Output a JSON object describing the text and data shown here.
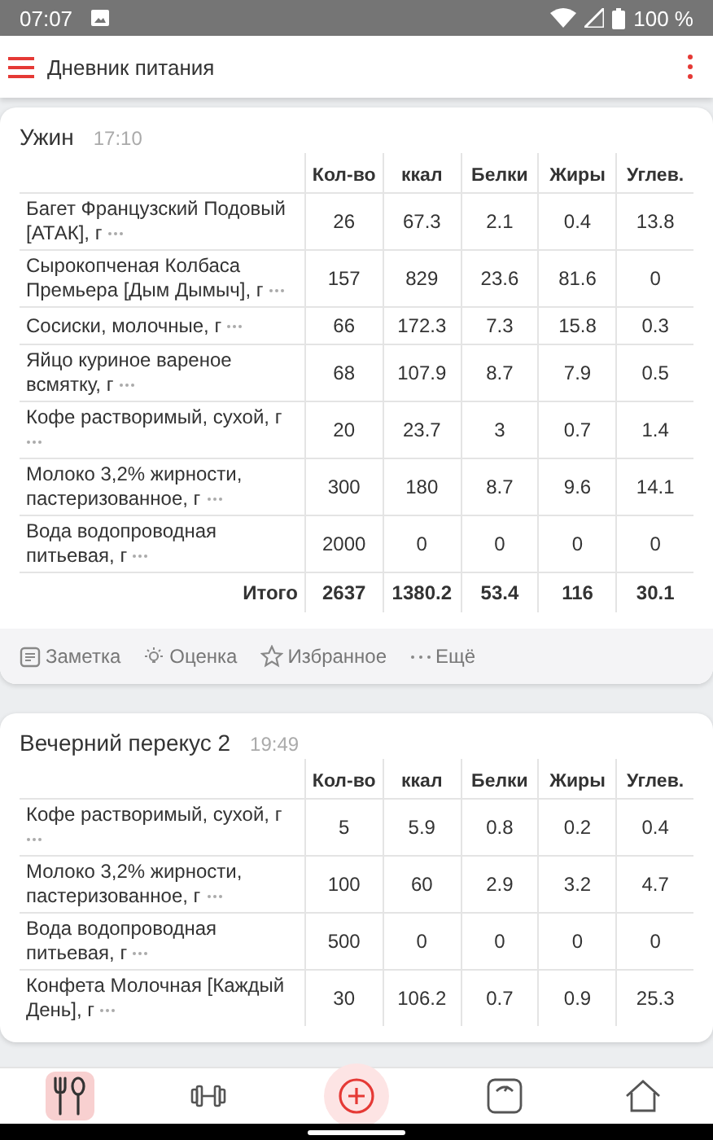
{
  "status_bar": {
    "time": "07:07",
    "battery": "100 %"
  },
  "app_bar": {
    "title": "Дневник питания"
  },
  "meals": [
    {
      "name": "Ужин",
      "time": "17:10",
      "columns": [
        "Кол-во",
        "ккал",
        "Белки",
        "Жиры",
        "Углев."
      ],
      "rows": [
        {
          "name": "Багет Французский Подовый [АТАК], г",
          "values": [
            "26",
            "67.3",
            "2.1",
            "0.4",
            "13.8"
          ]
        },
        {
          "name": "Сырокопченая Колбаса Премьера [Дым Дымыч], г",
          "values": [
            "157",
            "829",
            "23.6",
            "81.6",
            "0"
          ]
        },
        {
          "name": "Сосиски, молочные, г",
          "values": [
            "66",
            "172.3",
            "7.3",
            "15.8",
            "0.3"
          ]
        },
        {
          "name": "Яйцо куриное вареное всмятку, г",
          "values": [
            "68",
            "107.9",
            "8.7",
            "7.9",
            "0.5"
          ]
        },
        {
          "name": "Кофе растворимый, сухой, г",
          "values": [
            "20",
            "23.7",
            "3",
            "0.7",
            "1.4"
          ]
        },
        {
          "name": "Молоко 3,2% жирности, пастеризованное, г",
          "values": [
            "300",
            "180",
            "8.7",
            "9.6",
            "14.1"
          ]
        },
        {
          "name": "Вода водопроводная питьевая, г",
          "values": [
            "2000",
            "0",
            "0",
            "0",
            "0"
          ]
        }
      ],
      "total": {
        "label": "Итого",
        "values": [
          "2637",
          "1380.2",
          "53.4",
          "116",
          "30.1"
        ]
      },
      "actions": [
        {
          "kind": "note",
          "label": "Заметка"
        },
        {
          "kind": "rating",
          "label": "Оценка"
        },
        {
          "kind": "favorite",
          "label": "Избранное"
        },
        {
          "kind": "more",
          "label": "Ещё"
        }
      ]
    },
    {
      "name": "Вечерний перекус 2",
      "time": "19:49",
      "columns": [
        "Кол-во",
        "ккал",
        "Белки",
        "Жиры",
        "Углев."
      ],
      "rows": [
        {
          "name": "Кофе растворимый, сухой, г",
          "values": [
            "5",
            "5.9",
            "0.8",
            "0.2",
            "0.4"
          ]
        },
        {
          "name": "Молоко 3,2% жирности, пастеризованное, г",
          "values": [
            "100",
            "60",
            "2.9",
            "3.2",
            "4.7"
          ]
        },
        {
          "name": "Вода водопроводная питьевая, г",
          "values": [
            "500",
            "0",
            "0",
            "0",
            "0"
          ]
        },
        {
          "name": "Конфета Молочная [Каждый День], г",
          "values": [
            "30",
            "106.2",
            "0.7",
            "0.9",
            "25.3"
          ]
        }
      ]
    }
  ],
  "bottom_nav": [
    {
      "kind": "diary",
      "selected": true
    },
    {
      "kind": "fitness",
      "selected": false
    },
    {
      "kind": "add",
      "selected": true
    },
    {
      "kind": "weight",
      "selected": false
    },
    {
      "kind": "home",
      "selected": false
    }
  ]
}
